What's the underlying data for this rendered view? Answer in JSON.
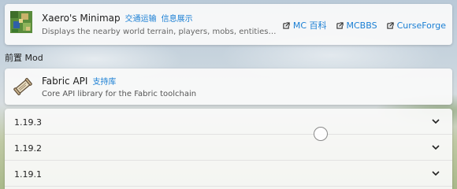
{
  "mod": {
    "title": "Xaero's Minimap",
    "tags": [
      "交通运输",
      "信息展示"
    ],
    "description": "Displays the nearby world terrain, players, mobs, entities in the...",
    "icon": "minimap-icon",
    "links": [
      {
        "label": "MC 百科",
        "icon": "external-link-icon"
      },
      {
        "label": "MCBBS",
        "icon": "external-link-icon"
      },
      {
        "label": "CurseForge",
        "icon": "external-link-icon"
      }
    ]
  },
  "dependencies": {
    "section_label": "前置 Mod",
    "items": [
      {
        "title": "Fabric API",
        "tag": "支持库",
        "description": "Core API library for the Fabric toolchain",
        "icon": "scroll-icon"
      }
    ]
  },
  "versions": [
    {
      "label": "1.19.3"
    },
    {
      "label": "1.19.2"
    },
    {
      "label": "1.19.1"
    }
  ],
  "colors": {
    "accent": "#1a7fd4"
  }
}
